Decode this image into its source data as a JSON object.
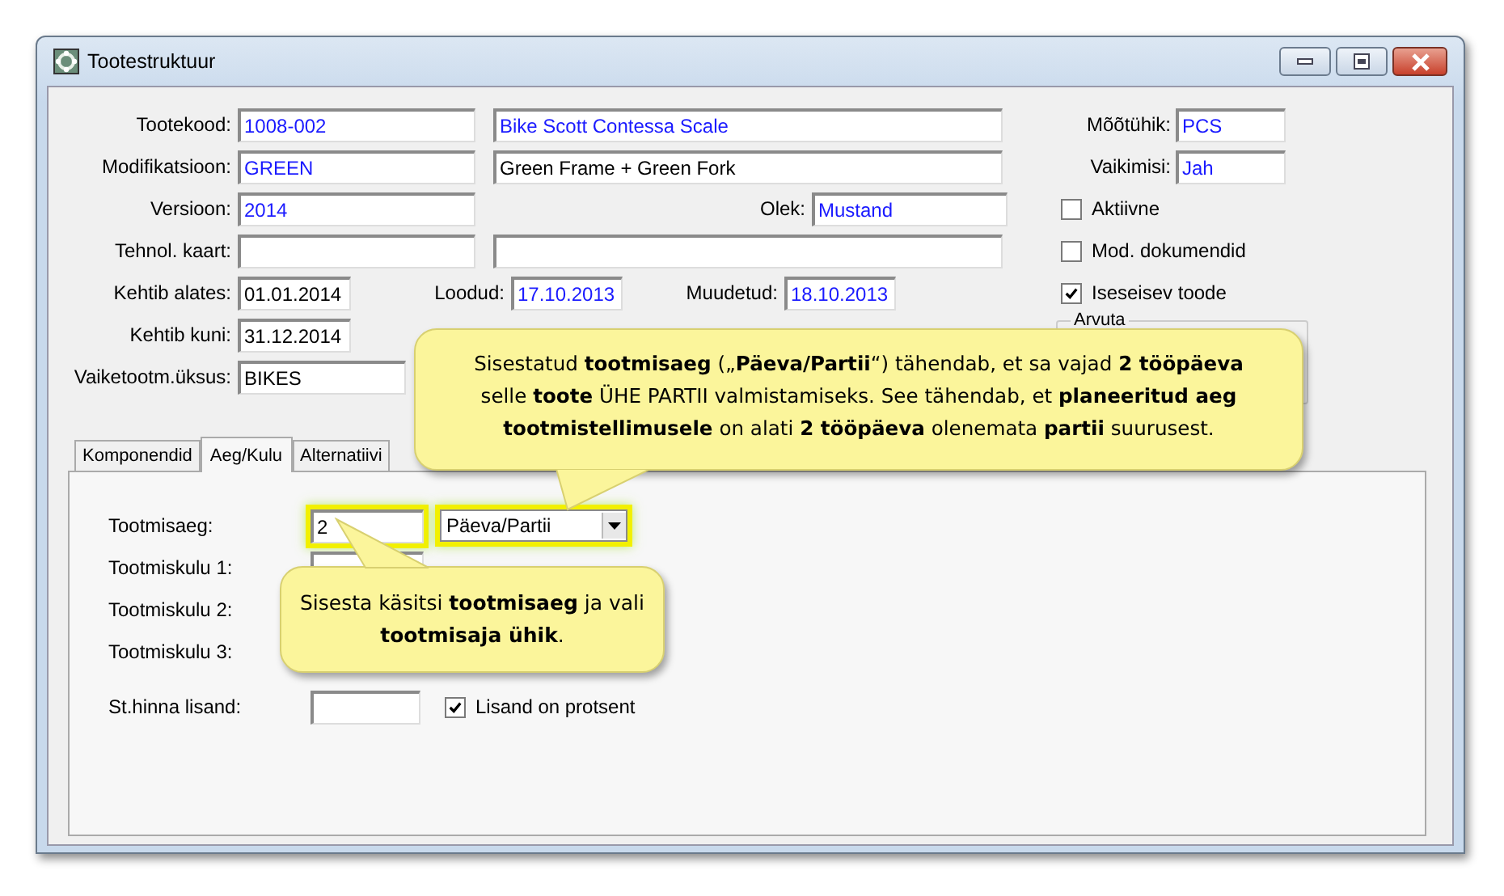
{
  "window": {
    "title": "Tootestruktuur"
  },
  "header": {
    "product_code": {
      "label": "Tootekood:",
      "value": "1008-002",
      "kind": "lookup"
    },
    "product_name": {
      "value": "Bike Scott Contessa Scale",
      "kind": "lookup"
    },
    "modification": {
      "label": "Modifikatsioon:",
      "value": "GREEN",
      "kind": "lookup"
    },
    "modification_name": {
      "value": "Green Frame + Green Fork"
    },
    "version": {
      "label": "Versioon:",
      "value": "2014",
      "kind": "lookup"
    },
    "status": {
      "label": "Olek:",
      "value": "Mustand",
      "kind": "lookup"
    },
    "tech_card": {
      "label": "Tehnol. kaart:"
    },
    "valid_from": {
      "label": "Kehtib alates:",
      "value": "01.01.2014"
    },
    "created": {
      "label": "Loodud:",
      "value": "17.10.2013",
      "kind": "lookup"
    },
    "modified": {
      "label": "Muudetud:",
      "value": "18.10.2013",
      "kind": "lookup"
    },
    "valid_to": {
      "label": "Kehtib kuni:",
      "value": "31.12.2014"
    },
    "default_unit": {
      "label": "Vaiketootm.üksus:",
      "value": "BIKES"
    },
    "uom": {
      "label": "Mõõtühik:",
      "value": "PCS",
      "kind": "lookup"
    },
    "default": {
      "label": "Vaikimisi:",
      "value": "Jah",
      "kind": "lookup"
    },
    "checkboxes": [
      {
        "label": "Aktiivne",
        "checked": false
      },
      {
        "label": "Mod. dokumendid",
        "checked": false
      },
      {
        "label": "Iseseisev toode",
        "checked": true
      }
    ],
    "group": {
      "title": "Arvuta"
    }
  },
  "tabs": [
    {
      "label": "Komponendid",
      "selected": false
    },
    {
      "label": "Aeg/Kulu",
      "selected": true
    },
    {
      "label": "Alternatiivi",
      "selected": false
    }
  ],
  "time_cost": {
    "production_time": {
      "label": "Tootmisaeg:",
      "value": "2",
      "highlighted": true
    },
    "unit": {
      "value": "Päeva/Partii",
      "highlighted": true
    },
    "costs": [
      {
        "label": "Tootmiskulu 1:"
      },
      {
        "label": "Tootmiskulu 2:"
      },
      {
        "label": "Tootmiskulu 3:"
      }
    ],
    "surcharge": {
      "label": "St.hinna lisand:"
    },
    "percent": {
      "label": "Lisand on protsent",
      "checked": true
    }
  },
  "callouts": [
    {
      "text": "Sisestatud **tootmisaeg** („**Päeva/Partii**“) tähendab, et sa vajad **2 tööpäeva** selle **toote** ÜHE PARTII valmistamiseks.  See tähendab, et **planeeritud aeg tootmistellimusele** on alati **2 tööpäeva** olenemata **partii** suurusest."
    },
    {
      "text": "Sisesta käsitsi **tootmisaeg** ja vali **tootmisaja ühik**."
    }
  ]
}
